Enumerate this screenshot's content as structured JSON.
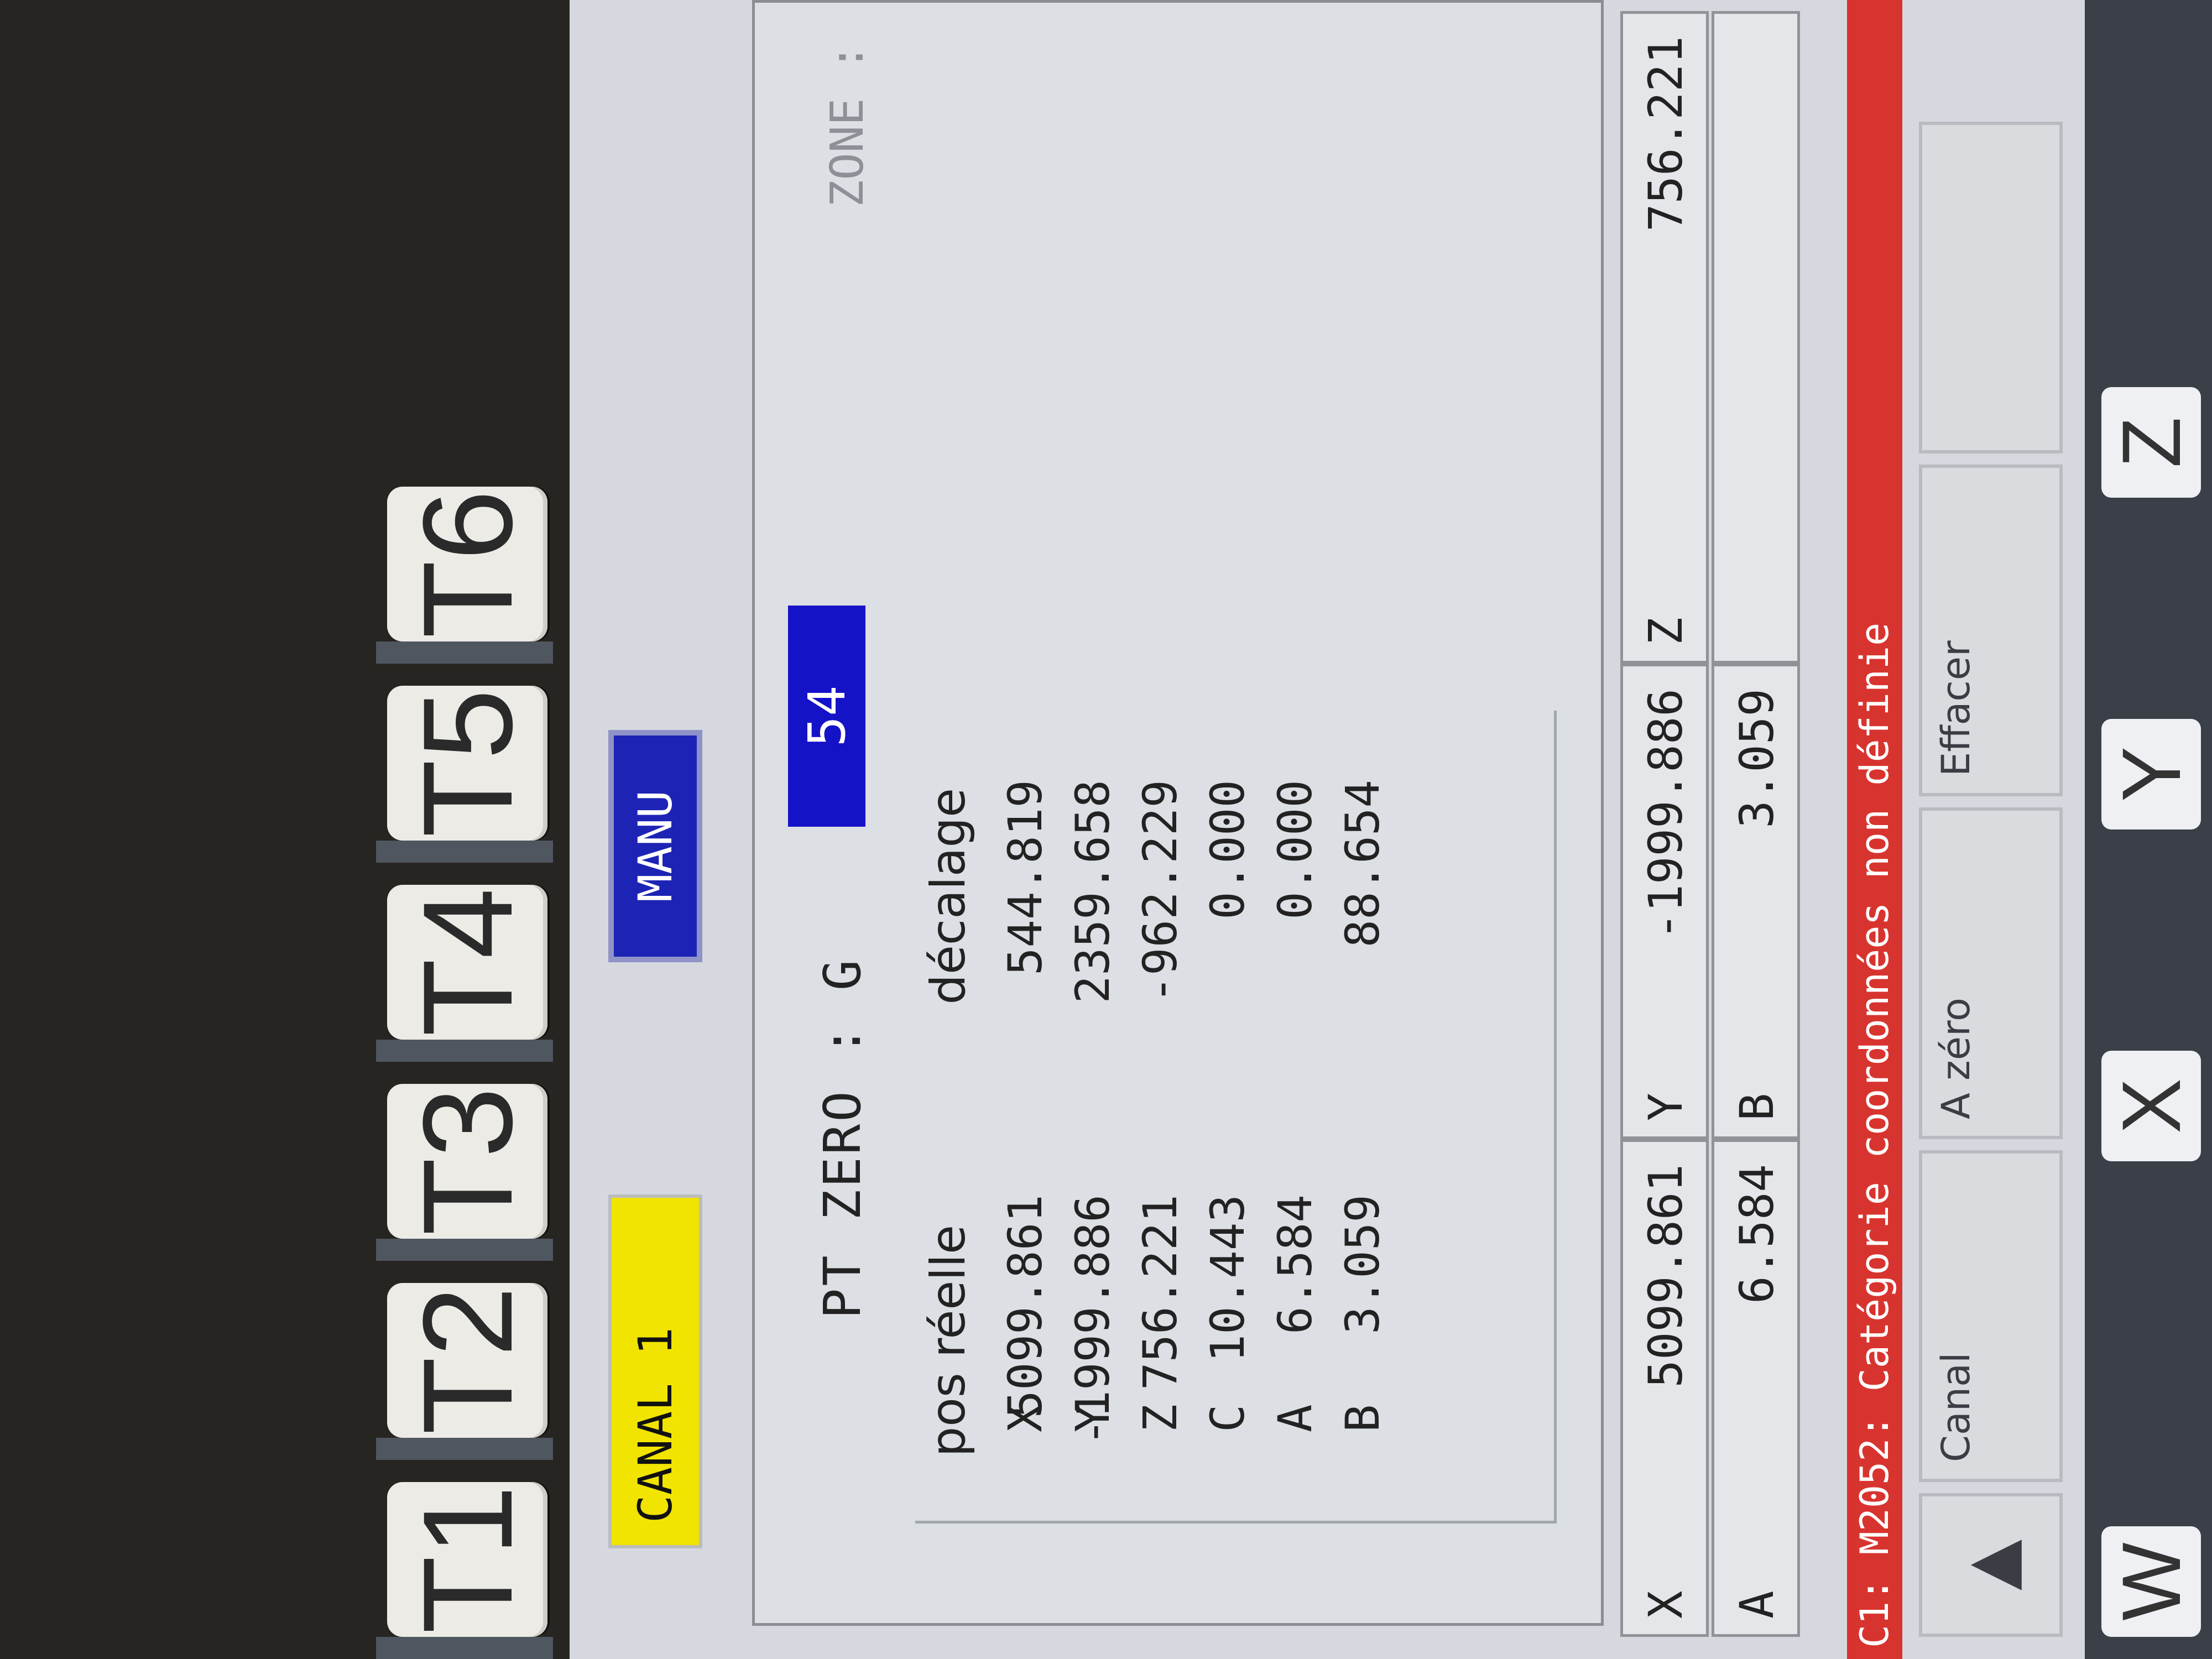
{
  "hardware_keys": [
    "T1",
    "T2",
    "T3",
    "T4",
    "T5",
    "T6"
  ],
  "status": {
    "canal": "CANAL 1",
    "mode": "MANU"
  },
  "zero_point": {
    "label": "PT ZERO : G",
    "g_value": "54",
    "zone_label": "ZONE :"
  },
  "table": {
    "headers": [
      "pos réelle",
      "décalage"
    ],
    "rows": [
      {
        "axis": "X",
        "pos": "5099.861",
        "offset": "544.819"
      },
      {
        "axis": "Y",
        "pos": "-1999.886",
        "offset": "2359.658"
      },
      {
        "axis": "Z",
        "pos": "756.221",
        "offset": "-962.229"
      },
      {
        "axis": "C",
        "pos": "10.443",
        "offset": "0.000"
      },
      {
        "axis": "A",
        "pos": "6.584",
        "offset": "0.000"
      },
      {
        "axis": "B",
        "pos": "3.059",
        "offset": "88.654"
      }
    ]
  },
  "position_bar": [
    {
      "axis": "X",
      "value": "5099.861"
    },
    {
      "axis": "Y",
      "value": "-1999.886"
    },
    {
      "axis": "Z",
      "value": "756.221"
    },
    {
      "axis": "A",
      "value": "6.584"
    },
    {
      "axis": "B",
      "value": "3.059"
    },
    {
      "axis": "",
      "value": ""
    }
  ],
  "message": "C1:  M2052: Catégorie coordonnées non définie",
  "softkeys": {
    "arrow_icon": "up-triangle-icon",
    "canal": "Canal",
    "a_zero": "A zéro",
    "effacer": "Effacer"
  },
  "keyboard_partial": [
    "W",
    "+",
    "X",
    "Y",
    "Z"
  ]
}
